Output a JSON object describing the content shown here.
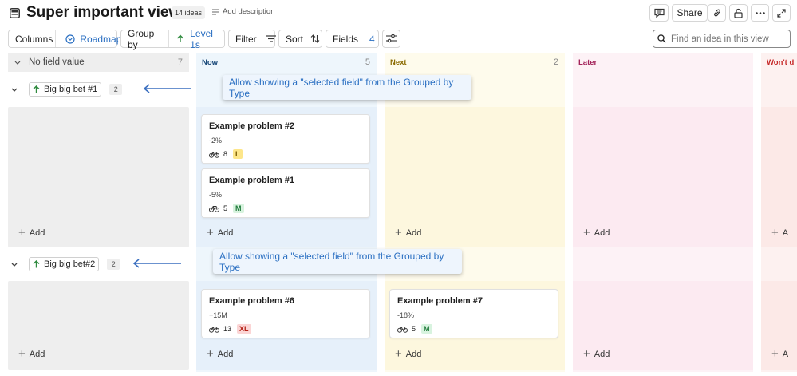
{
  "header": {
    "title": "Super important view",
    "ideas_count": "14 ideas",
    "add_description": "Add description",
    "share_label": "Share"
  },
  "toolbar": {
    "columns_label": "Columns",
    "columns_value": "Roadmap",
    "groupby_label": "Group by",
    "groupby_value": "Level 1s",
    "filter_label": "Filter",
    "sort_label": "Sort",
    "fields_label": "Fields",
    "fields_count": "4",
    "search_placeholder": "Find an idea in this view"
  },
  "columns": [
    {
      "label": "No field value",
      "count": "7"
    },
    {
      "label": "Now",
      "count": "5"
    },
    {
      "label": "Next",
      "count": "2"
    },
    {
      "label": "Later",
      "count": ""
    },
    {
      "label": "Won't d",
      "count": ""
    }
  ],
  "column_colors": {
    "none": "#eeeeee",
    "now": "#eef6fc",
    "next": "#fefbec",
    "later": "#fdf2f6",
    "wont": "#fdf1f0",
    "now_text": "#1b4a7a",
    "next_text": "#8a6a00",
    "later_text": "#a3245a",
    "wont_text": "#c62828"
  },
  "groups": [
    {
      "label": "Big big bet #1",
      "count": "2",
      "callout": "Allow showing a \"selected field\" from the Grouped by Type",
      "now_cards": [
        {
          "title": "Example problem #2",
          "metric": "-2%",
          "effort": "8",
          "size": "L"
        },
        {
          "title": "Example problem #1",
          "metric": "-5%",
          "effort": "5",
          "size": "M"
        }
      ]
    },
    {
      "label": "Big big bet#2",
      "count": "2",
      "callout": "Allow showing a \"selected field\" from the Grouped by Type",
      "now_cards": [
        {
          "title": "Example problem #6",
          "metric": "+15M",
          "effort": "13",
          "size": "XL"
        }
      ],
      "next_cards": [
        {
          "title": "Example problem #7",
          "metric": "-18%",
          "effort": "5",
          "size": "M"
        }
      ]
    }
  ],
  "add_label": "Add",
  "add_label_cut": "A",
  "size_colors": {
    "L": {
      "bg": "#fde68a",
      "fg": "#7a5a00"
    },
    "M": {
      "bg": "#d8f3df",
      "fg": "#1f7a3a"
    },
    "XL": {
      "bg": "#fbd5d5",
      "fg": "#b42318"
    }
  },
  "accent": "#2a6fc2"
}
